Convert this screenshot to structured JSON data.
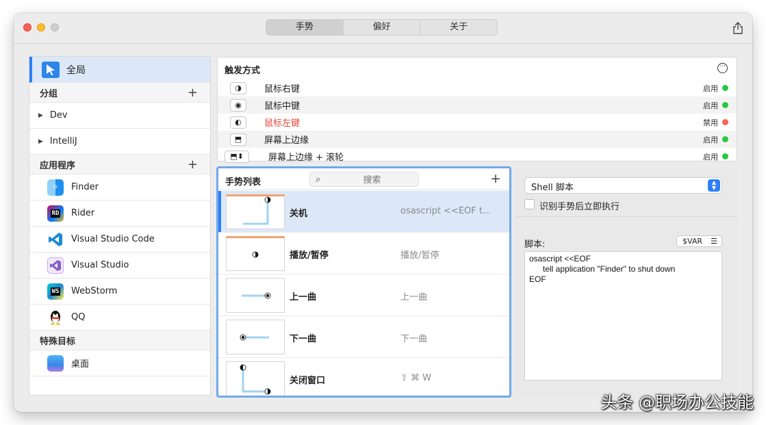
{
  "tabs": [
    "手势",
    "偏好",
    "关于"
  ],
  "sidebar": {
    "global_label": "全局",
    "groups_header": "分组",
    "groups": [
      "Dev",
      "IntelliJ"
    ],
    "apps_header": "应用程序",
    "apps": [
      "Finder",
      "Rider",
      "Visual Studio Code",
      "Visual Studio",
      "WebStorm",
      "QQ"
    ],
    "special_header": "特殊目标",
    "special_items": [
      "桌面"
    ]
  },
  "triggers": {
    "title": "触发方式",
    "items": [
      {
        "icon": "◑",
        "label": "鼠标右键",
        "state": "启用",
        "color": "#28c840"
      },
      {
        "icon": "◉",
        "label": "鼠标中键",
        "state": "启用",
        "color": "#28c840"
      },
      {
        "icon": "◐",
        "label": "鼠标左键",
        "state": "禁用",
        "color": "#fe5f57"
      },
      {
        "icon": "⬒",
        "label": "屏幕上边缘",
        "state": "启用",
        "color": "#28c840"
      },
      {
        "icon": "⬒⬍",
        "label": "屏幕上边缘 + 滚轮",
        "state": "启用",
        "color": "#28c840"
      }
    ]
  },
  "gestures": {
    "title": "手势列表",
    "search_placeholder": "搜索",
    "items": [
      {
        "name": "关机",
        "command": "osascript <<EOF   t..."
      },
      {
        "name": "播放/暂停",
        "command": "播放/暂停"
      },
      {
        "name": "上一曲",
        "command": "上一曲"
      },
      {
        "name": "下一曲",
        "command": "下一曲"
      },
      {
        "name": "关闭窗口",
        "command": "⇧ ⌘ W"
      }
    ]
  },
  "detail": {
    "action_type": "Shell 脚本",
    "execute_label": "识别手势后立即执行",
    "script_label": "脚本:",
    "var_button": "$VAR",
    "script": "osascript <<EOF\n      tell application \"Finder\" to shut down\nEOF"
  },
  "watermark": "头条 @职场办公技能"
}
